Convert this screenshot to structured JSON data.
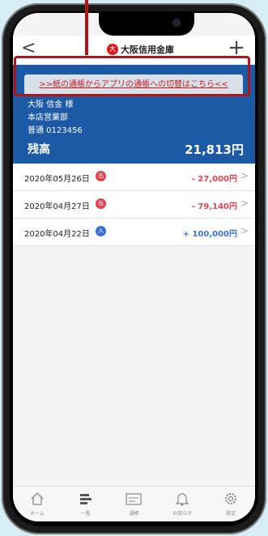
{
  "navbar": {
    "bank_name": "大阪信用金庫",
    "logo_mark": "大",
    "back_glyph": "<",
    "add_glyph": "+"
  },
  "banner": {
    "text": ">>紙の通帳からアプリの通帳への切替はこちら<<"
  },
  "account": {
    "holder": "大阪 信金 様",
    "branch": "本店営業部",
    "type_number": "普通 0123456",
    "balance_label": "残高",
    "balance_value": "21,813円"
  },
  "transactions": [
    {
      "date": "2020年05月26日",
      "badge": "出",
      "badge_color": "#e0424f",
      "amount": "- 27,000円",
      "amount_color": "#e0424f"
    },
    {
      "date": "2020年04月27日",
      "badge": "出",
      "badge_color": "#e0424f",
      "amount": "- 79,140円",
      "amount_color": "#e0424f"
    },
    {
      "date": "2020年04月22日",
      "badge": "入",
      "badge_color": "#3a6fd8",
      "amount": "+ 100,000円",
      "amount_color": "#3a6fd8"
    }
  ],
  "tabbar": [
    {
      "label": "ホーム",
      "icon": "home-icon"
    },
    {
      "label": "一覧",
      "icon": "list-icon"
    },
    {
      "label": "通帳",
      "icon": "passbook-icon"
    },
    {
      "label": "お知らせ",
      "icon": "bell-icon"
    },
    {
      "label": "設定",
      "icon": "gear-icon"
    }
  ],
  "colors": {
    "accent": "#1d5aa6",
    "callout": "#b01414",
    "debit": "#e0424f",
    "credit": "#3a6fd8"
  }
}
